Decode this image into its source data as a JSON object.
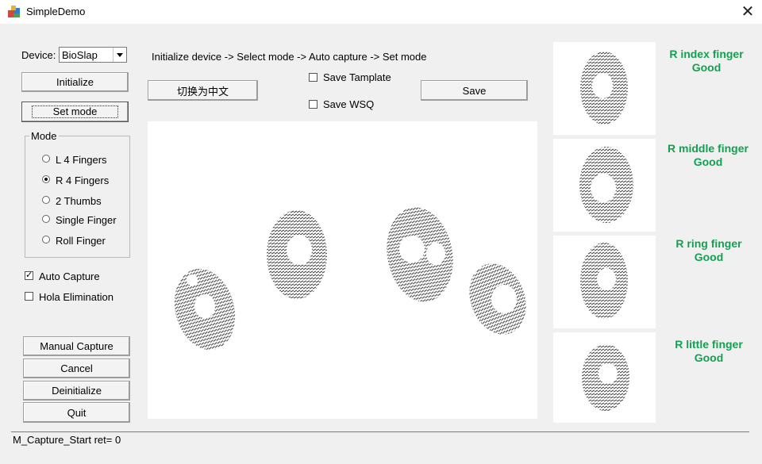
{
  "window": {
    "title": "SimpleDemo"
  },
  "device": {
    "label": "Device:",
    "selected": "BioSlap"
  },
  "instructions": "Initialize device -> Select mode -> Auto capture -> Set mode",
  "buttons": {
    "initialize": "Initialize",
    "set_mode": "Set mode",
    "language": "切换为中文",
    "save": "Save",
    "manual_capture": "Manual Capture",
    "cancel": "Cancel",
    "deinitialize": "Deinitialize",
    "quit": "Quit"
  },
  "checkboxes": {
    "save_template": {
      "label": "Save Tamplate",
      "checked": false
    },
    "save_wsq": {
      "label": "Save WSQ",
      "checked": false
    },
    "auto_capture": {
      "label": "Auto Capture",
      "checked": true
    },
    "hola_elimination": {
      "label": "Hola Elimination",
      "checked": false
    }
  },
  "mode": {
    "legend": "Mode",
    "options": [
      {
        "label": "L 4 Fingers",
        "selected": false
      },
      {
        "label": "R 4 Fingers",
        "selected": true
      },
      {
        "label": "2 Thumbs",
        "selected": false
      },
      {
        "label": "Single Finger",
        "selected": false
      },
      {
        "label": "Roll Finger",
        "selected": false
      }
    ]
  },
  "fingers": [
    {
      "name": "R index finger",
      "quality": "Good"
    },
    {
      "name": "R middle finger",
      "quality": "Good"
    },
    {
      "name": "R ring finger",
      "quality": "Good"
    },
    {
      "name": "R little finger",
      "quality": "Good"
    }
  ],
  "status": "M_Capture_Start  ret= 0",
  "colors": {
    "quality_text": "#14a050",
    "window_bg": "#f0f0f0"
  }
}
